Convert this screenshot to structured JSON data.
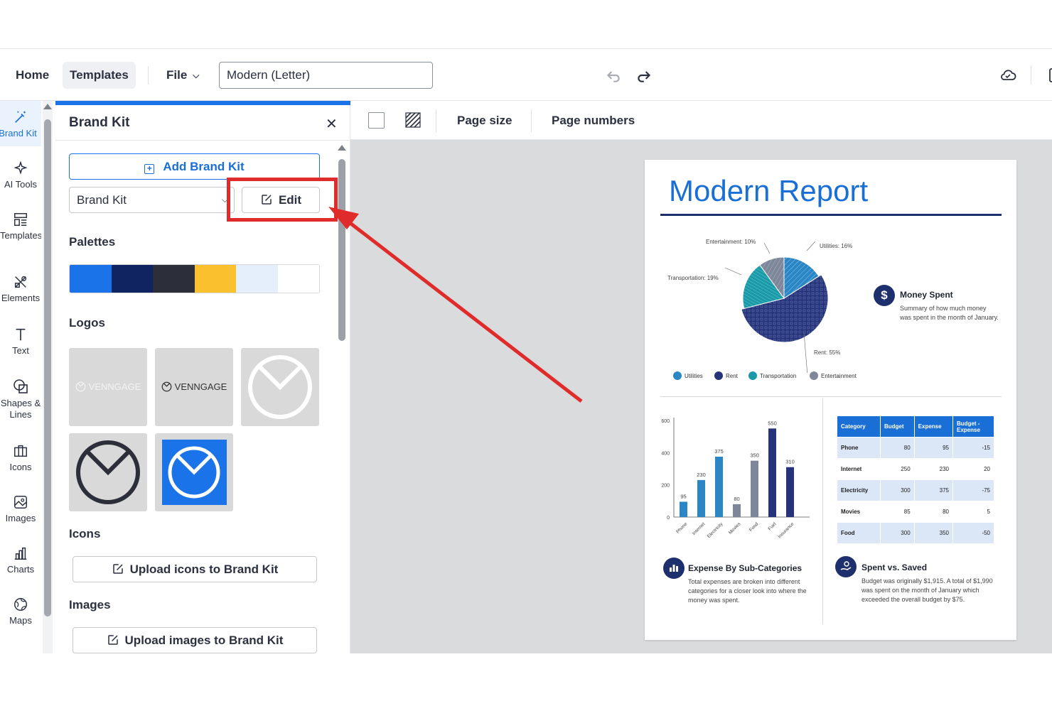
{
  "topbar": {
    "home": "Home",
    "templates": "Templates",
    "file": "File",
    "doc_title": "Modern (Letter)"
  },
  "rail": {
    "items": [
      {
        "label": "Brand Kit",
        "icon": "magic-wand-icon",
        "active": true
      },
      {
        "label": "AI Tools",
        "icon": "sparkles-icon"
      },
      {
        "label": "Templates",
        "icon": "layout-icon"
      },
      {
        "label": "Elements",
        "icon": "elements-icon"
      },
      {
        "label": "Text",
        "icon": "text-icon"
      },
      {
        "label": "Shapes & Lines",
        "icon": "shapes-icon"
      },
      {
        "label": "Icons",
        "icon": "briefcase-icon"
      },
      {
        "label": "Images",
        "icon": "image-icon"
      },
      {
        "label": "Charts",
        "icon": "bar-chart-icon"
      },
      {
        "label": "Maps",
        "icon": "globe-icon"
      }
    ]
  },
  "panel": {
    "title": "Brand Kit",
    "add_kit": "Add Brand Kit",
    "kit_select": "Brand Kit",
    "edit": "Edit",
    "palettes_label": "Palettes",
    "palette": [
      "#1a73e8",
      "#0f2461",
      "#2c2f3a",
      "#fbc02d",
      "#e5effb",
      "#ffffff"
    ],
    "logos_label": "Logos",
    "logo_text": "VENNGAGE",
    "icons_label": "Icons",
    "upload_icons": "Upload icons to Brand Kit",
    "images_label": "Images",
    "upload_images": "Upload images to Brand Kit"
  },
  "canvas_toolbar": {
    "page_size": "Page size",
    "page_numbers": "Page numbers"
  },
  "doc": {
    "title": "Modern Report",
    "pie_labels": {
      "entertainment": "Entertainment: 10%",
      "utilities": "Utilities: 16%",
      "transportation": "Transportation: 19%",
      "rent": "Rent: 55%"
    },
    "money_spent": {
      "heading": "Money Spent",
      "body": "Summary of how much money was spent in the month of January."
    },
    "legend": [
      "Utilities",
      "Rent",
      "Transportation",
      "Entertainment"
    ],
    "expense_cat": {
      "heading": "Expense By Sub-Categories",
      "body": "Total expenses are broken into different categories for a closer look into where the money was spent."
    },
    "spent_saved": {
      "heading": "Spent vs. Saved",
      "body": "Budget was originally $1,915. A total of $1,990 was spent on the month of January which exceeded the overall budget by $75."
    },
    "table": {
      "headers": [
        "Category",
        "Budget",
        "Expense",
        "Budget - Expense"
      ],
      "rows": [
        [
          "Phone",
          "80",
          "95",
          "-15"
        ],
        [
          "Internet",
          "250",
          "230",
          "20"
        ],
        [
          "Electricity",
          "300",
          "375",
          "-75"
        ],
        [
          "Movies",
          "85",
          "80",
          "5"
        ],
        [
          "Food",
          "300",
          "350",
          "-50"
        ]
      ]
    }
  },
  "chart_data": [
    {
      "type": "pie",
      "categories": [
        "Utilities",
        "Rent",
        "Transportation",
        "Entertainment"
      ],
      "values": [
        16,
        55,
        19,
        10
      ],
      "colors": [
        "#2b86c5",
        "#26337a",
        "#1a9aa8",
        "#7d8799"
      ]
    },
    {
      "type": "bar",
      "categories": [
        "Phone",
        "Internet",
        "Electricity",
        "Movies",
        "Food",
        "Fuel",
        "Insurance"
      ],
      "values": [
        95,
        230,
        375,
        80,
        350,
        550,
        310
      ],
      "ylim": [
        0,
        600
      ],
      "yticks": [
        0,
        200,
        400,
        600
      ],
      "colors": [
        "#2b86c5",
        "#2b86c5",
        "#2b86c5",
        "#7d8799",
        "#7d8799",
        "#26337a",
        "#26337a"
      ]
    }
  ]
}
